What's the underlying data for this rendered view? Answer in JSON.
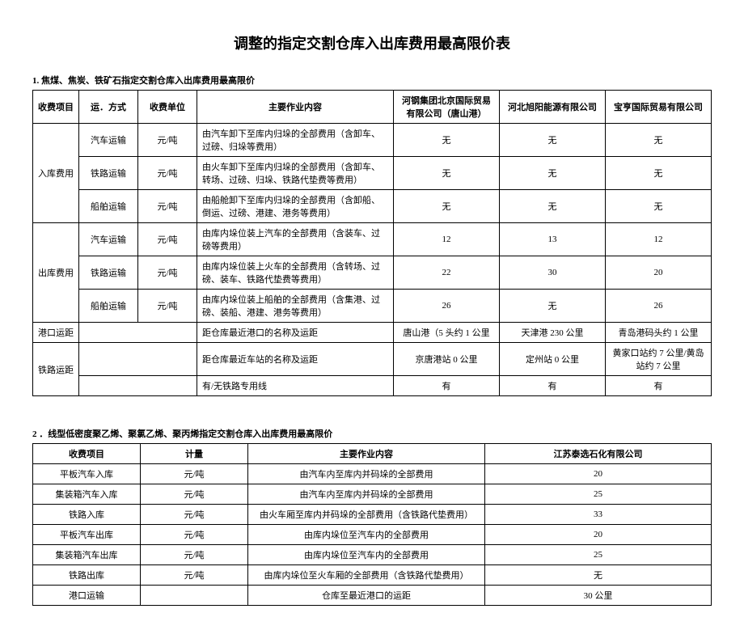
{
  "title": "调整的指定交割仓库入出库费用最高限价表",
  "section1": {
    "label": "1. 焦煤、焦炭、铁矿石指定交割仓库入出库费用最高限价",
    "headers": {
      "feeItem": "收费项目",
      "method": "运．方式",
      "unit": "收费单位",
      "desc": "主要作业内容",
      "comp1": "河钢集团北京国际贸易有限公司（唐山港）",
      "comp2": "河北旭阳能源有限公司",
      "comp3": "宝亨国际贸易有限公司"
    },
    "inGroup": "入库费用",
    "outGroup": "出库费用",
    "portGroup": "港口运距",
    "railGroup": "铁路运距",
    "rows": {
      "in1": {
        "method": "汽车运输",
        "unit": "元/吨",
        "desc": "由汽车卸下至库内归垛的全部费用（含卸车、过磅、归垛等费用）",
        "v1": "无",
        "v2": "无",
        "v3": "无"
      },
      "in2": {
        "method": "铁路运输",
        "unit": "元/吨",
        "desc": "由火车卸下至库内归垛的全部费用（含卸车、转场、过磅、归垛、铁路代垫费等费用）",
        "v1": "无",
        "v2": "无",
        "v3": "无"
      },
      "in3": {
        "method": "船舶运输",
        "unit": "元/吨",
        "desc": "由船舱卸下至库内归垛的全部费用（含卸船、倒运、过磅、港建、港务等费用）",
        "v1": "无",
        "v2": "无",
        "v3": "无"
      },
      "out1": {
        "method": "汽车运输",
        "unit": "元/吨",
        "desc": "由库内垛位装上汽车的全部费用（含装车、过磅等费用）",
        "v1": "12",
        "v2": "13",
        "v3": "12"
      },
      "out2": {
        "method": "铁路运输",
        "unit": "元/吨",
        "desc": "由库内垛位装上火车的全部费用（含转场、过磅、装车、铁路代垫费等费用）",
        "v1": "22",
        "v2": "30",
        "v3": "20"
      },
      "out3": {
        "method": "船舶运输",
        "unit": "元/吨",
        "desc": "由库内垛位装上船舶的全部费用（含集港、过磅、装船、港建、港务等费用）",
        "v1": "26",
        "v2": "无",
        "v3": "26"
      },
      "port": {
        "desc": "距仓库最近港口的名称及运距",
        "v1": "唐山港（5 头约 1 公里",
        "v2": "天津港 230 公里",
        "v3": "青岛港码头约 1 公里"
      },
      "rail1": {
        "desc": "距仓库最近车站的名称及运距",
        "v1": "京唐港站 0 公里",
        "v2": "定州站 0 公里",
        "v3": "黄家口站约 7 公里/黄岛站约 7 公里"
      },
      "rail2": {
        "desc": "有/无铁路专用线",
        "v1": "有",
        "v2": "有",
        "v3": "有"
      }
    }
  },
  "section2": {
    "label": "2 ．线型低密度聚乙烯、聚氯乙烯、聚丙烯指定交割仓库入出库费用最高限价",
    "headers": {
      "item": "收费项目",
      "unit": "计量",
      "desc": "主要作业内容",
      "comp": "江苏泰选石化有限公司"
    },
    "rows": {
      "r1": {
        "item": "平板汽车入库",
        "unit": "元/吨",
        "desc": "由汽车内至库内并码垛的全部费用",
        "v": "20"
      },
      "r2": {
        "item": "集装箱汽车入库",
        "unit": "元/吨",
        "desc": "由汽车内至库内并码垛的全部费用",
        "v": "25"
      },
      "r3": {
        "item": "铁路入库",
        "unit": "元/吨",
        "desc": "由火车厢至库内并码垛的全部费用（含铁路代垫费用）",
        "v": "33"
      },
      "r4": {
        "item": "平板汽车出库",
        "unit": "元/吨",
        "desc": "由库内垛位至汽车内的全部费用",
        "v": "20"
      },
      "r5": {
        "item": "集装箱汽车出库",
        "unit": "元/吨",
        "desc": "由库内垛位至汽车内的全部费用",
        "v": "25"
      },
      "r6": {
        "item": "铁路出库",
        "unit": "元/吨",
        "desc": "由库内垛位至火车厢的全部费用（含铁路代垫费用）",
        "v": "无"
      },
      "r7": {
        "item": "港口运输",
        "unit": "",
        "desc": "仓库至最近港口的运距",
        "v": "30 公里"
      }
    }
  }
}
